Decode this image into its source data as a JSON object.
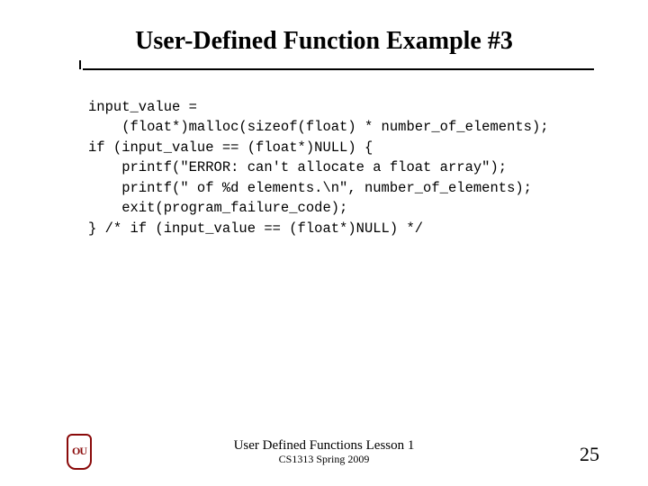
{
  "title": "User-Defined Function Example #3",
  "code_lines": [
    "input_value =",
    "    (float*)malloc(sizeof(float) * number_of_elements);",
    "if (input_value == (float*)NULL) {",
    "    printf(\"ERROR: can't allocate a float array\");",
    "    printf(\" of %d elements.\\n\", number_of_elements);",
    "    exit(program_failure_code);",
    "} /* if (input_value == (float*)NULL) */"
  ],
  "footer": {
    "line1": "User Defined Functions Lesson 1",
    "line2": "CS1313 Spring 2009"
  },
  "page_number": "25",
  "logo_text": "OU"
}
